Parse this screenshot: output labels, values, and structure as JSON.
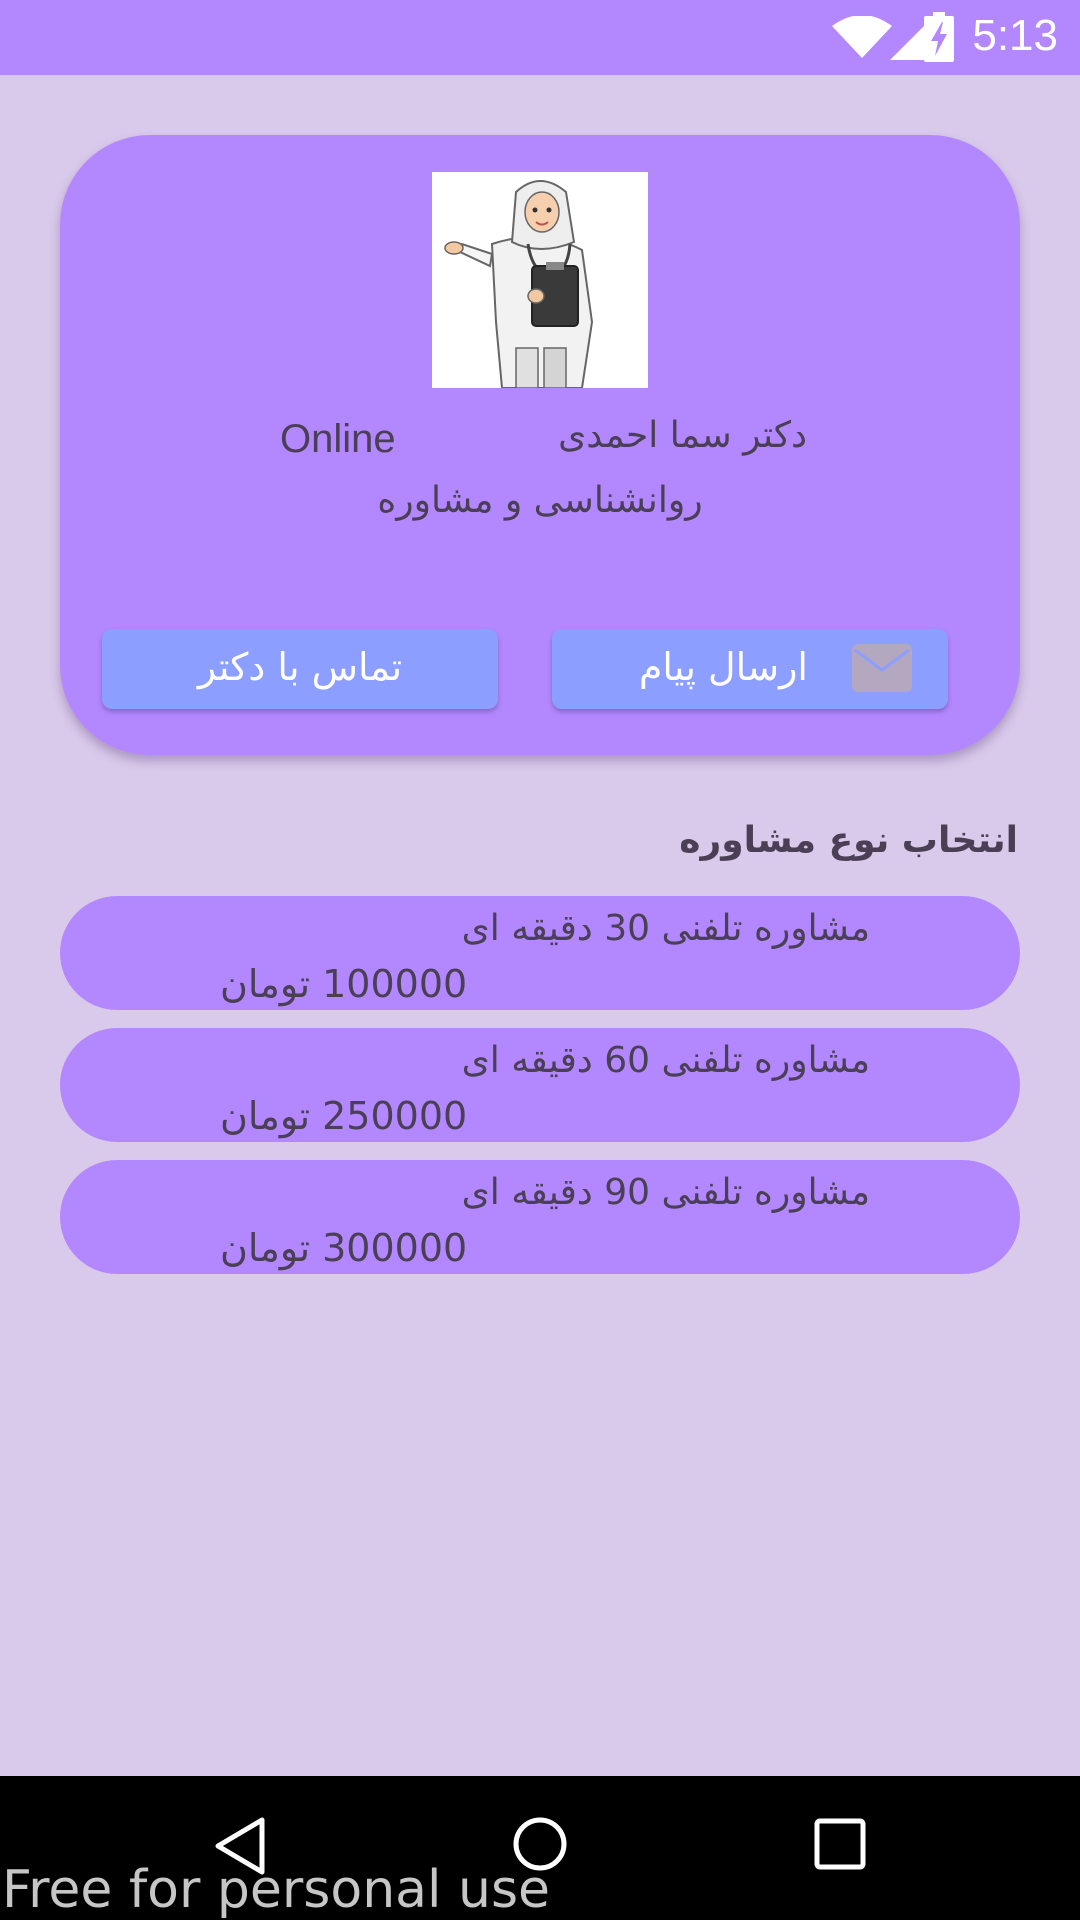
{
  "status_bar": {
    "time": "5:13",
    "icons": [
      "wifi-icon",
      "cellular-signal-icon",
      "battery-charging-icon"
    ],
    "background": "#b388ff"
  },
  "doctor": {
    "name": "دکتر سما احمدی",
    "status": "Online",
    "specialty": "روانشناسی و مشاوره"
  },
  "actions": {
    "message_label": "ارسال پیام",
    "call_label": "تماس با دکتر",
    "button_color": "#8c9eff"
  },
  "consultation": {
    "section_title": "انتخاب نوع مشاوره",
    "options": [
      {
        "title": "مشاوره تلفنی 30 دقیقه ای",
        "price": "100000 تومان"
      },
      {
        "title": "مشاوره تلفنی 60 دقیقه ای",
        "price": "250000 تومان"
      },
      {
        "title": "مشاوره تلفنی 90 دقیقه ای",
        "price": "300000 تومان"
      }
    ]
  },
  "navigation": {
    "icons": [
      "back-icon",
      "home-icon",
      "recents-icon"
    ]
  },
  "watermark": "Free for personal use",
  "colors": {
    "background": "#d9c9ea",
    "card": "#b388ff",
    "text": "#4a3f55"
  }
}
